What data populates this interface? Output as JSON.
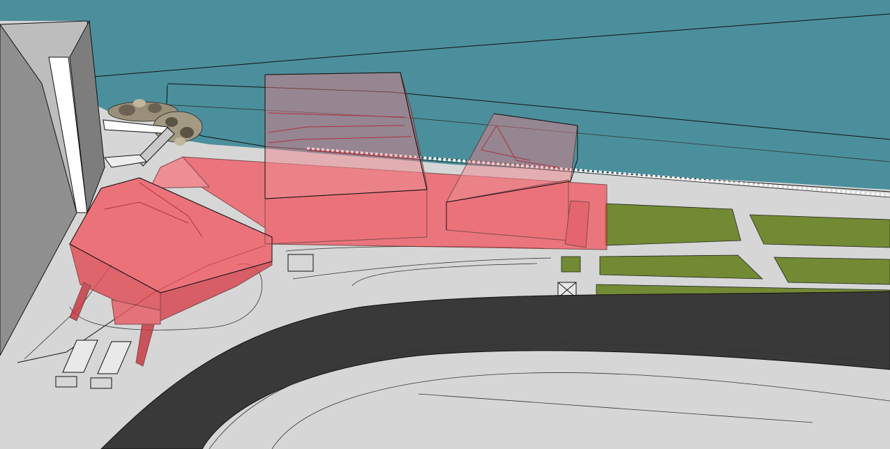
{
  "scene": {
    "colors": {
      "water": "#4b8f9c",
      "ground": "#d6d6d6",
      "road": "#3a3939",
      "lawn": "#728a34",
      "tower": "#8a8a8a",
      "mass": "#f2505a",
      "rocks": "#9a8f78"
    }
  }
}
